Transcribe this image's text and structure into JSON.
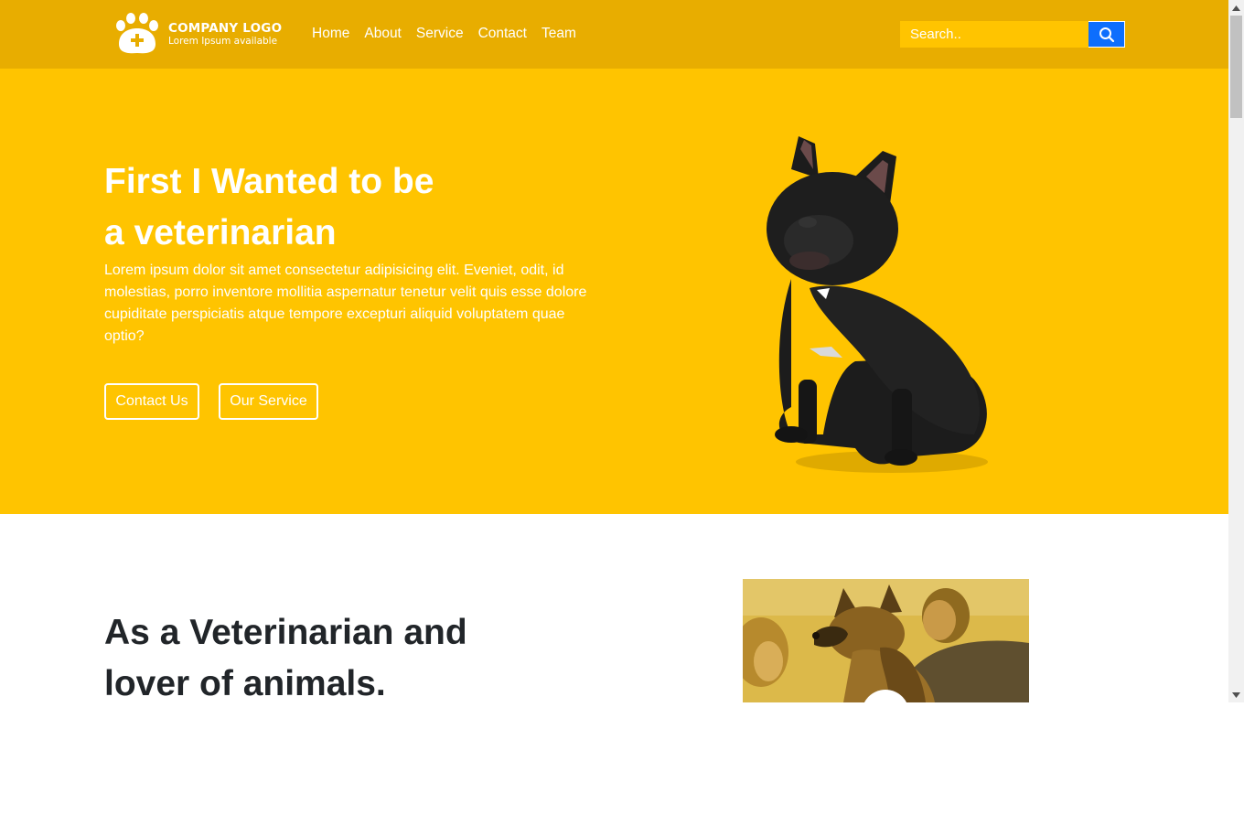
{
  "navbar": {
    "logo": {
      "title": "COMPANY LOGO",
      "subtitle": "Lorem Ipsum available"
    },
    "links": [
      "Home",
      "About",
      "Service",
      "Contact",
      "Team"
    ],
    "search": {
      "placeholder": "Search.."
    }
  },
  "hero": {
    "title_line1": "First I Wanted to be",
    "title_line2": "a veterinarian",
    "text": "Lorem ipsum dolor sit amet consectetur adipisicing elit. Eveniet, odit, id molestias, porro inventore mollitia aspernatur tenetur velit quis esse dolore cupiditate perspiciatis atque tempore excepturi aliquid voluptatem quae optio?",
    "contact_button": "Contact Us",
    "service_button": "Our Service"
  },
  "about": {
    "title_line1": "As a Veterinarian and",
    "title_line2": "lover of animals."
  },
  "colors": {
    "navbar": "#e8ad00",
    "hero": "#ffc400",
    "search_button": "#0d6efd",
    "text_dark": "#212529"
  },
  "icons": {
    "logo": "paw-cross-icon",
    "search": "search-icon",
    "play": "play-icon",
    "scroll_up": "arrow-up-icon",
    "scroll_down": "arrow-down-icon"
  }
}
